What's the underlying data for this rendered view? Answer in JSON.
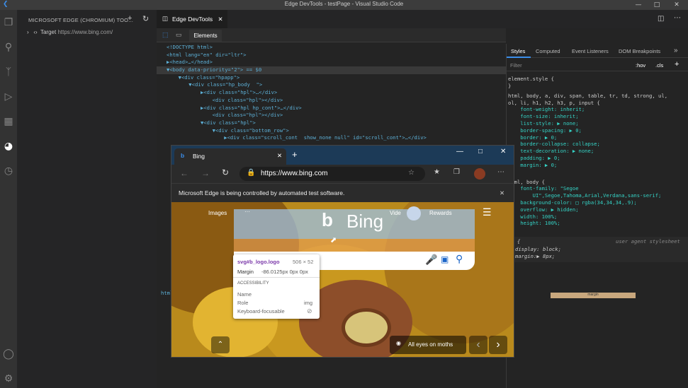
{
  "window": {
    "title": "Edge DevTools - testPage - Visual Studio Code"
  },
  "sidebar": {
    "header": "MICROSOFT EDGE (CHROMIUM) TOO...",
    "target_label": "Target",
    "target_url": "https://www.bing.com/"
  },
  "editor": {
    "tab_label": "Edge DevTools"
  },
  "devtools": {
    "elements_tab": "Elements",
    "dom_lines": [
      {
        "text": "<!DOCTYPE html>"
      },
      {
        "text": "<html lang=\"en\" dir=\"ltr\">"
      },
      {
        "text": "▶<head>…</head>"
      },
      {
        "text": "▼<body data-priority=\"2\"> == $0"
      },
      {
        "text": "  ▼<div class=\"hpapp\">"
      },
      {
        "text": "    ▼<div class=\"hp_body  \">"
      },
      {
        "text": "      ▶<div class=\"hpl\">…</div>"
      },
      {
        "text": "        <div class=\"hpl\"></div>"
      },
      {
        "text": "      ▶<div class=\"hpl hp_cont\">…</div>"
      },
      {
        "text": "        <div class=\"hpl\"></div>"
      },
      {
        "text": "      ▼<div class=\"hpl\">"
      },
      {
        "text": "        ▼<div class=\"bottom_row\">"
      },
      {
        "text": "          ▶<div class=\"scroll_cont  show_none null\" id=\"scroll_cont\">…</div>"
      }
    ],
    "breadcrumb": "html",
    "styles_tabs": [
      "Styles",
      "Computed",
      "Event Listeners",
      "DOM Breakpoints"
    ],
    "filter_placeholder": "Filter",
    "hov": ":hov",
    "cls": ".cls",
    "style_lines": [
      "element.style {",
      "}",
      "html, body, a, div, span, table, tr, td, strong, ul,",
      "ol, li, h1, h2, h3, p, input {",
      "    font-weight: inherit;",
      "    font-size: inherit;",
      "    list-style: ▶ none;",
      "    border-spacing: ▶ 0;",
      "    border: ▶ 0;",
      "    border-collapse: collapse;",
      "    text-decoration: ▶ none;",
      "    padding: ▶ 0;",
      "    margin: ▶ 0;",
      "}",
      "html, body {",
      "    font-family: \"Segoe",
      "        UI\",Segoe,Tahoma,Arial,Verdana,sans-serif;",
      "    background-color: □ rgba(34,34,34,.9);",
      "    overflow: ▶ hidden;",
      "    width: 100%;",
      "    height: 100%;",
      "}"
    ],
    "ua_selector": "dy {",
    "ua_label": "user agent stylesheet",
    "ua_lines": [
      "display: block;",
      "margin:▶ 8px;"
    ],
    "box_label": "margin"
  },
  "browser": {
    "tab_title": "Bing",
    "url": "https://www.bing.com",
    "infobar": "Microsoft Edge is being controlled by automated test software.",
    "nav": {
      "images": "Images",
      "more": "···",
      "videos": "Vide",
      "rewards": "Rewards"
    },
    "logo_text": "Bing",
    "location_label": "All eyes on moths",
    "colors": {
      "tabbar": "#1c3a57",
      "highlight": "#9fc1e3",
      "margin_overlay": "#f0a55a"
    }
  },
  "tooltip": {
    "selector": "svg#b_logo.logo",
    "size": "506 × 52",
    "margin_label": "Margin",
    "margin_value": "-86.0125px 0px 0px",
    "section": "ACCESSIBILITY",
    "name_label": "Name",
    "name_value": "",
    "role_label": "Role",
    "role_value": "img",
    "kf_label": "Keyboard-focusable",
    "kf_icon": "not-allowed-icon"
  }
}
